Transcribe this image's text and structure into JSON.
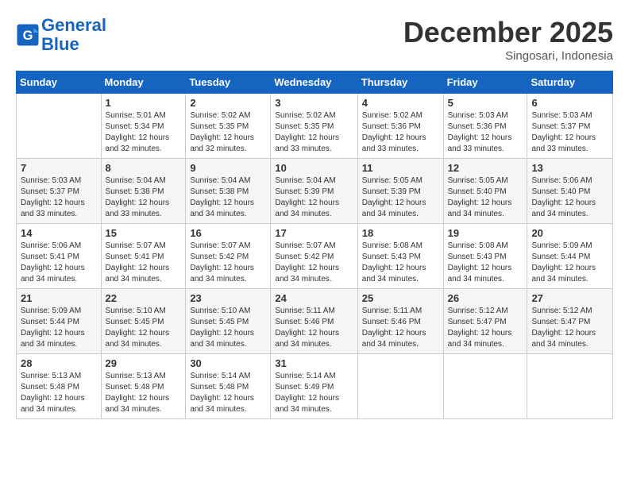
{
  "header": {
    "logo_line1": "General",
    "logo_line2": "Blue",
    "month": "December 2025",
    "location": "Singosari, Indonesia"
  },
  "weekdays": [
    "Sunday",
    "Monday",
    "Tuesday",
    "Wednesday",
    "Thursday",
    "Friday",
    "Saturday"
  ],
  "weeks": [
    [
      {
        "day": "",
        "info": ""
      },
      {
        "day": "1",
        "info": "Sunrise: 5:01 AM\nSunset: 5:34 PM\nDaylight: 12 hours\nand 32 minutes."
      },
      {
        "day": "2",
        "info": "Sunrise: 5:02 AM\nSunset: 5:35 PM\nDaylight: 12 hours\nand 32 minutes."
      },
      {
        "day": "3",
        "info": "Sunrise: 5:02 AM\nSunset: 5:35 PM\nDaylight: 12 hours\nand 33 minutes."
      },
      {
        "day": "4",
        "info": "Sunrise: 5:02 AM\nSunset: 5:36 PM\nDaylight: 12 hours\nand 33 minutes."
      },
      {
        "day": "5",
        "info": "Sunrise: 5:03 AM\nSunset: 5:36 PM\nDaylight: 12 hours\nand 33 minutes."
      },
      {
        "day": "6",
        "info": "Sunrise: 5:03 AM\nSunset: 5:37 PM\nDaylight: 12 hours\nand 33 minutes."
      }
    ],
    [
      {
        "day": "7",
        "info": "Sunrise: 5:03 AM\nSunset: 5:37 PM\nDaylight: 12 hours\nand 33 minutes."
      },
      {
        "day": "8",
        "info": "Sunrise: 5:04 AM\nSunset: 5:38 PM\nDaylight: 12 hours\nand 33 minutes."
      },
      {
        "day": "9",
        "info": "Sunrise: 5:04 AM\nSunset: 5:38 PM\nDaylight: 12 hours\nand 34 minutes."
      },
      {
        "day": "10",
        "info": "Sunrise: 5:04 AM\nSunset: 5:39 PM\nDaylight: 12 hours\nand 34 minutes."
      },
      {
        "day": "11",
        "info": "Sunrise: 5:05 AM\nSunset: 5:39 PM\nDaylight: 12 hours\nand 34 minutes."
      },
      {
        "day": "12",
        "info": "Sunrise: 5:05 AM\nSunset: 5:40 PM\nDaylight: 12 hours\nand 34 minutes."
      },
      {
        "day": "13",
        "info": "Sunrise: 5:06 AM\nSunset: 5:40 PM\nDaylight: 12 hours\nand 34 minutes."
      }
    ],
    [
      {
        "day": "14",
        "info": "Sunrise: 5:06 AM\nSunset: 5:41 PM\nDaylight: 12 hours\nand 34 minutes."
      },
      {
        "day": "15",
        "info": "Sunrise: 5:07 AM\nSunset: 5:41 PM\nDaylight: 12 hours\nand 34 minutes."
      },
      {
        "day": "16",
        "info": "Sunrise: 5:07 AM\nSunset: 5:42 PM\nDaylight: 12 hours\nand 34 minutes."
      },
      {
        "day": "17",
        "info": "Sunrise: 5:07 AM\nSunset: 5:42 PM\nDaylight: 12 hours\nand 34 minutes."
      },
      {
        "day": "18",
        "info": "Sunrise: 5:08 AM\nSunset: 5:43 PM\nDaylight: 12 hours\nand 34 minutes."
      },
      {
        "day": "19",
        "info": "Sunrise: 5:08 AM\nSunset: 5:43 PM\nDaylight: 12 hours\nand 34 minutes."
      },
      {
        "day": "20",
        "info": "Sunrise: 5:09 AM\nSunset: 5:44 PM\nDaylight: 12 hours\nand 34 minutes."
      }
    ],
    [
      {
        "day": "21",
        "info": "Sunrise: 5:09 AM\nSunset: 5:44 PM\nDaylight: 12 hours\nand 34 minutes."
      },
      {
        "day": "22",
        "info": "Sunrise: 5:10 AM\nSunset: 5:45 PM\nDaylight: 12 hours\nand 34 minutes."
      },
      {
        "day": "23",
        "info": "Sunrise: 5:10 AM\nSunset: 5:45 PM\nDaylight: 12 hours\nand 34 minutes."
      },
      {
        "day": "24",
        "info": "Sunrise: 5:11 AM\nSunset: 5:46 PM\nDaylight: 12 hours\nand 34 minutes."
      },
      {
        "day": "25",
        "info": "Sunrise: 5:11 AM\nSunset: 5:46 PM\nDaylight: 12 hours\nand 34 minutes."
      },
      {
        "day": "26",
        "info": "Sunrise: 5:12 AM\nSunset: 5:47 PM\nDaylight: 12 hours\nand 34 minutes."
      },
      {
        "day": "27",
        "info": "Sunrise: 5:12 AM\nSunset: 5:47 PM\nDaylight: 12 hours\nand 34 minutes."
      }
    ],
    [
      {
        "day": "28",
        "info": "Sunrise: 5:13 AM\nSunset: 5:48 PM\nDaylight: 12 hours\nand 34 minutes."
      },
      {
        "day": "29",
        "info": "Sunrise: 5:13 AM\nSunset: 5:48 PM\nDaylight: 12 hours\nand 34 minutes."
      },
      {
        "day": "30",
        "info": "Sunrise: 5:14 AM\nSunset: 5:48 PM\nDaylight: 12 hours\nand 34 minutes."
      },
      {
        "day": "31",
        "info": "Sunrise: 5:14 AM\nSunset: 5:49 PM\nDaylight: 12 hours\nand 34 minutes."
      },
      {
        "day": "",
        "info": ""
      },
      {
        "day": "",
        "info": ""
      },
      {
        "day": "",
        "info": ""
      }
    ]
  ]
}
